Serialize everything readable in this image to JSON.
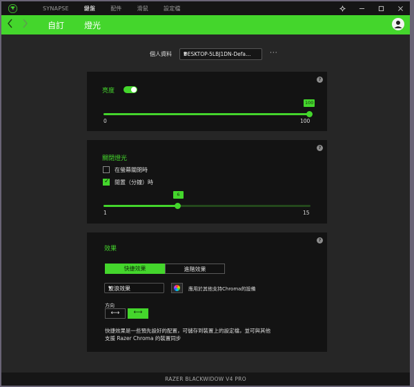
{
  "topnav": {
    "items": [
      "SYNAPSE",
      "鍵盤",
      "配件",
      "滑鼠",
      "設定檔"
    ],
    "active_index": 1
  },
  "window_controls": [
    "settings",
    "minimize",
    "maximize",
    "close"
  ],
  "header": {
    "back_icon": "chevron-left-icon",
    "forward_icon": "chevron-right-icon",
    "sub_items": [
      "自訂",
      "燈光"
    ],
    "active_sub": "燈光",
    "accent_color": "#44d62c"
  },
  "profile": {
    "label": "個人資料",
    "value": "DESKTOP-5LBJ1DN-Defa…",
    "more": "···"
  },
  "brightness": {
    "label": "亮度",
    "enabled": true,
    "value": 100,
    "value_text": "100",
    "min": 0,
    "max": 100,
    "min_text": "0",
    "max_text": "100",
    "help": "?"
  },
  "switch_off_lighting": {
    "title": "關閉燈光",
    "option_display_off": {
      "label": "在螢幕關閉時",
      "checked": false
    },
    "option_idle": {
      "label": "閒置（分鐘）時",
      "checked": true
    },
    "idle_minutes": 6,
    "idle_text": "6",
    "min": 1,
    "max": 15,
    "min_text": "1",
    "max_text": "15",
    "help": "?"
  },
  "effects": {
    "title": "效果",
    "tabs": [
      "快捷效果",
      "進階效果"
    ],
    "active_tab": 0,
    "effect_select": "波浪效果",
    "chroma_icon": "color-wheel-icon",
    "chroma_text": "應用於其他支持Chroma的設備",
    "direction_label": "方向",
    "direction_buttons": [
      "⟷",
      "⟷"
    ],
    "direction_active": 1,
    "desc_line1": "快捷效果是一些預先設好的配置，可儲存到裝置上的設定檔，並可與其他",
    "desc_line2": "支援 Razer Chroma 的裝置同步",
    "help": "?"
  },
  "footer": {
    "device": "RAZER BLACKWIDOW V4 PRO"
  }
}
